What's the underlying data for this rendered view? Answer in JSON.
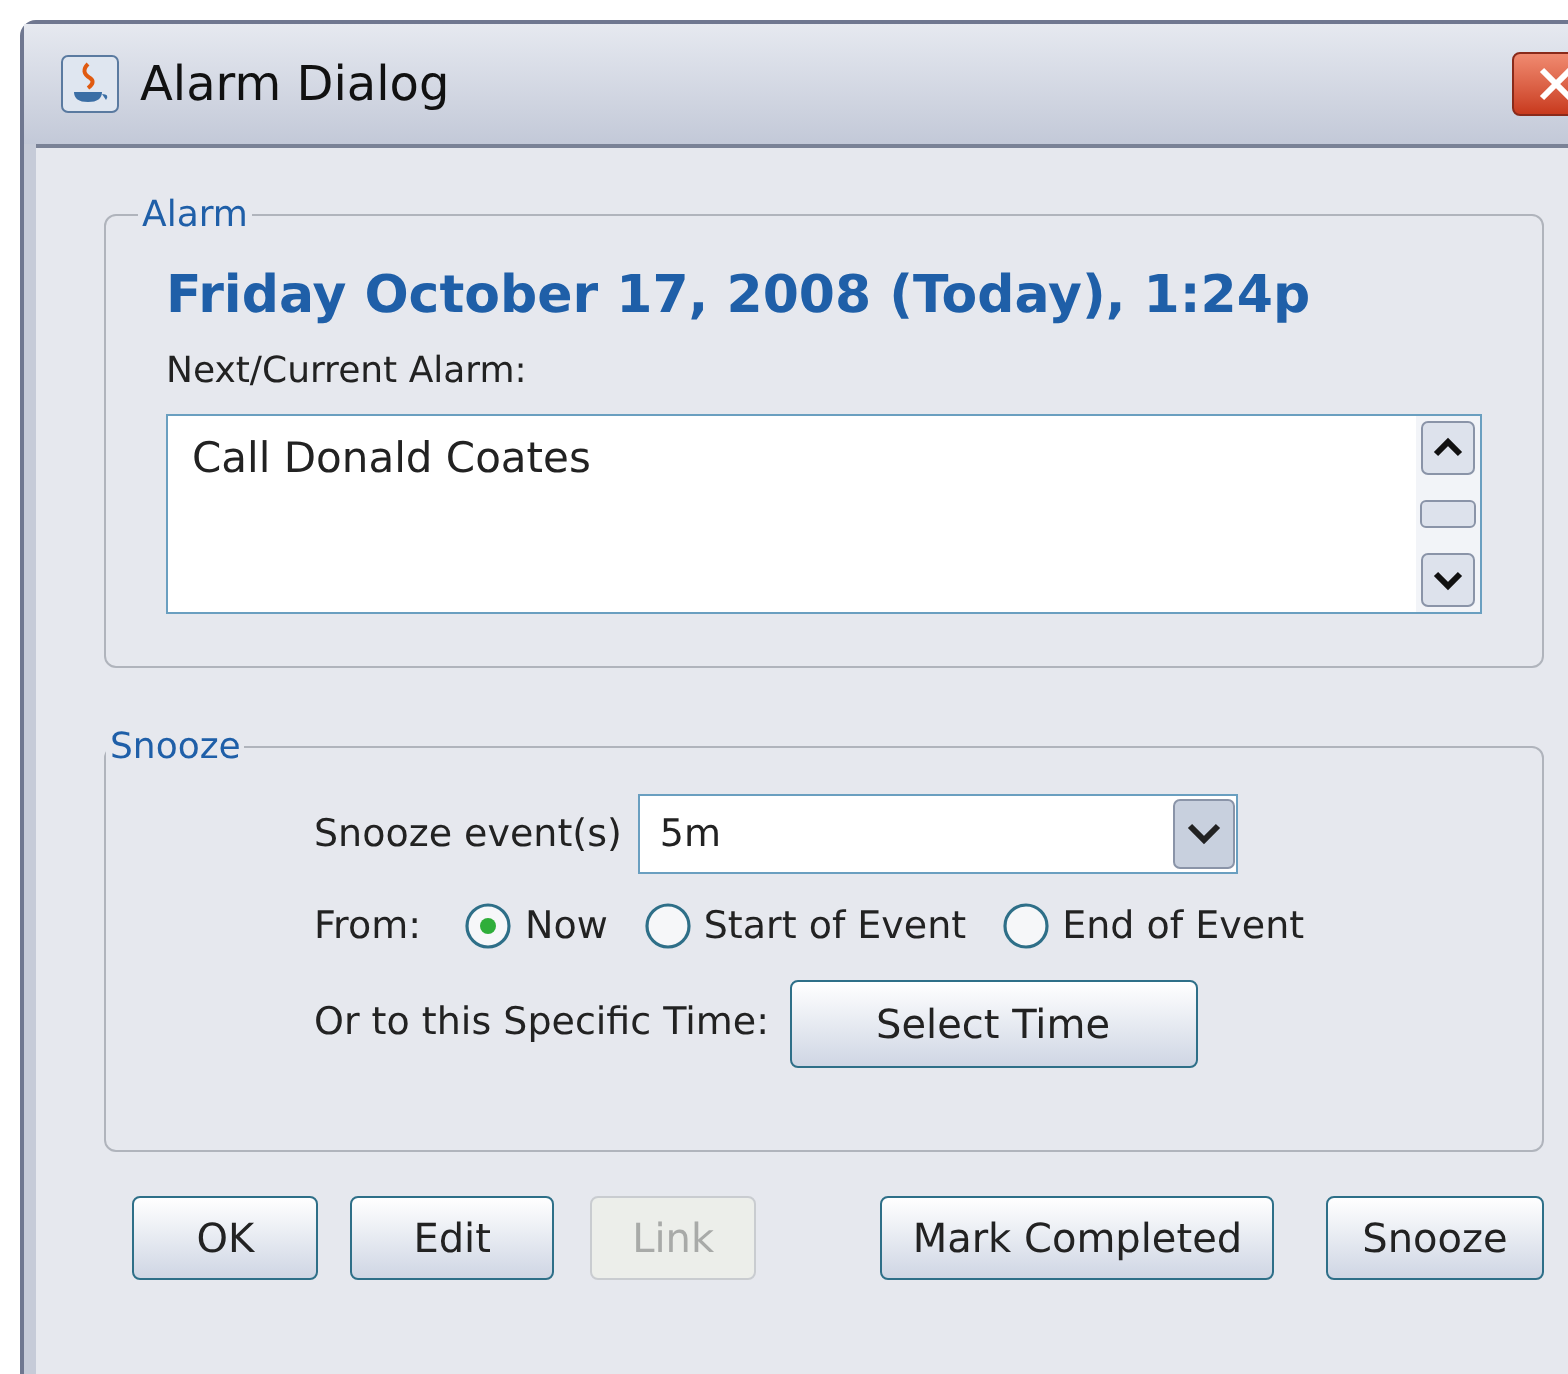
{
  "window": {
    "title": "Alarm Dialog"
  },
  "alarm": {
    "legend": "Alarm",
    "date": "Friday October 17, 2008 (Today), 1:24p",
    "label": "Next/Current Alarm:",
    "text": "Call Donald Coates"
  },
  "snooze": {
    "legend": "Snooze",
    "label": "Snooze event(s)",
    "value": "5m",
    "from_label": "From:",
    "options": [
      {
        "label": "Now",
        "selected": true
      },
      {
        "label": "Start of Event",
        "selected": false
      },
      {
        "label": "End of Event",
        "selected": false
      }
    ],
    "specific_label": "Or to this Specific Time:",
    "select_button": "Select Time"
  },
  "buttons": [
    {
      "label": "OK",
      "disabled": false
    },
    {
      "label": "Edit",
      "disabled": false
    },
    {
      "label": "Link",
      "disabled": true
    },
    {
      "label": "Mark Completed",
      "disabled": false
    },
    {
      "label": "Snooze",
      "disabled": false
    }
  ]
}
